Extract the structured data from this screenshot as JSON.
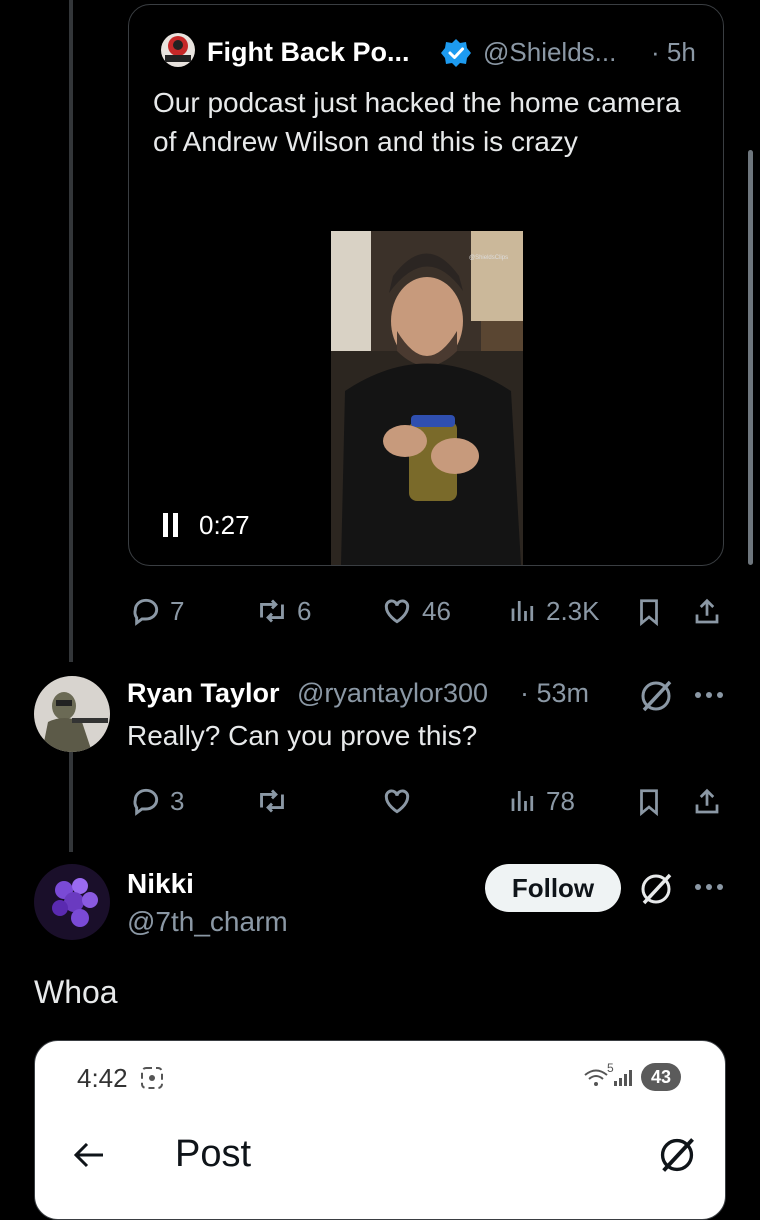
{
  "quoted_post": {
    "name": "Fight Back Po...",
    "handle": "@Shields...",
    "time": "· 5h",
    "text": "Our podcast just hacked the home camera of Andrew Wilson and this is crazy",
    "video": {
      "watermark": "@ShieldsClips",
      "duration": "0:27",
      "state": "playing"
    },
    "actions": {
      "replies": "7",
      "reposts": "6",
      "likes": "46",
      "views": "2.3K"
    }
  },
  "reply": {
    "name": "Ryan Taylor",
    "handle": "@ryantaylor300",
    "time": "· 53m",
    "text": "Really? Can you prove this?",
    "actions": {
      "replies": "3",
      "reposts": "",
      "likes": "",
      "views": "78"
    }
  },
  "reply2": {
    "name": "Nikki",
    "handle": "@7th_charm",
    "follow_label": "Follow",
    "text": "Whoa"
  },
  "embedded_screenshot": {
    "status_time": "4:42",
    "battery": "43",
    "signal": "5",
    "header_title": "Post"
  },
  "colors": {
    "background": "#000000",
    "text_primary": "#e7e9ea",
    "text_secondary": "#8b98a5",
    "verified_blue": "#1d9bf0"
  }
}
